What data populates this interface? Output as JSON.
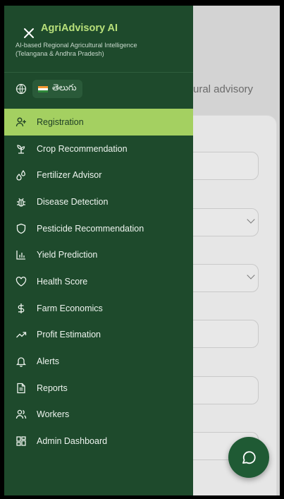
{
  "app": {
    "title": "AgriAdvisory AI",
    "subtitle_line1": "AI-based Regional Agricultural Intelligence",
    "subtitle_line2": "(Telangana & Andhra Pradesh)"
  },
  "language": {
    "label": "తెలుగు",
    "flag": "india-flag-icon"
  },
  "background": {
    "page_subtitle_fragment": "ural advisory"
  },
  "menu": {
    "items": [
      {
        "label": "Registration",
        "icon": "user-plus-icon",
        "active": true
      },
      {
        "label": "Crop Recommendation",
        "icon": "sprout-icon",
        "active": false
      },
      {
        "label": "Fertilizer Advisor",
        "icon": "droplets-icon",
        "active": false
      },
      {
        "label": "Disease Detection",
        "icon": "bug-icon",
        "active": false
      },
      {
        "label": "Pesticide Recommendation",
        "icon": "shield-icon",
        "active": false
      },
      {
        "label": "Yield Prediction",
        "icon": "bar-chart-icon",
        "active": false
      },
      {
        "label": "Health Score",
        "icon": "heart-icon",
        "active": false
      },
      {
        "label": "Farm Economics",
        "icon": "dollar-icon",
        "active": false
      },
      {
        "label": "Profit Estimation",
        "icon": "trending-up-icon",
        "active": false
      },
      {
        "label": "Alerts",
        "icon": "bell-icon",
        "active": false
      },
      {
        "label": "Reports",
        "icon": "file-text-icon",
        "active": false
      },
      {
        "label": "Workers",
        "icon": "users-icon",
        "active": false
      },
      {
        "label": "Admin Dashboard",
        "icon": "dashboard-icon",
        "active": false
      }
    ]
  },
  "colors": {
    "drawer_bg": "#1e4a2c",
    "active_bg": "#a4d061",
    "brand": "#b8e07a",
    "fab": "#1f5a34"
  }
}
